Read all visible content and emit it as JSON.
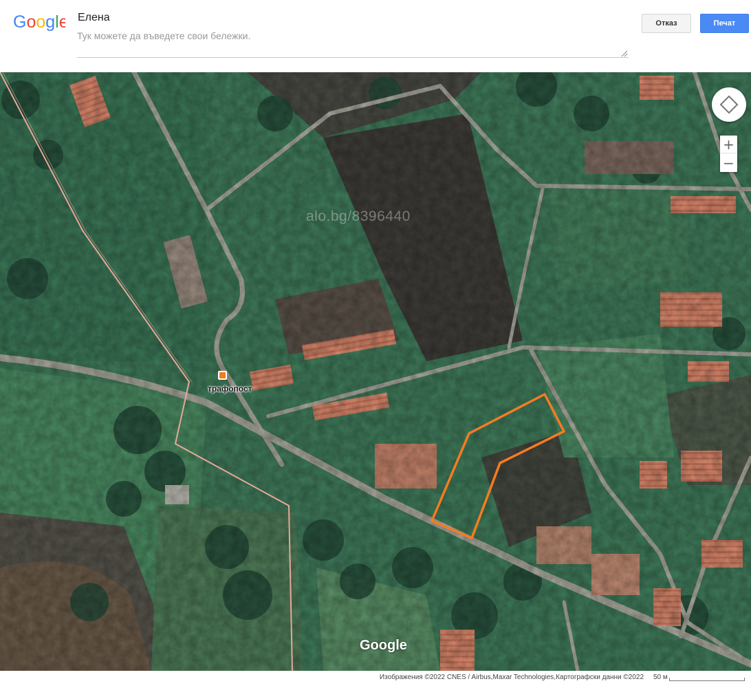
{
  "header": {
    "logo_text": "Google",
    "logo_colors": [
      "#4285F4",
      "#EA4335",
      "#FBBC05",
      "#4285F4",
      "#34A853",
      "#EA4335"
    ],
    "title": "Елена",
    "notes_placeholder": "Тук можете да въведете свои бележки.",
    "cancel_label": "Отказ",
    "print_label": "Печат"
  },
  "map": {
    "view": "satellite",
    "watermark": "alo.bg/8396440",
    "poi": {
      "label": "трафопост",
      "icon": "square-marker-icon",
      "color": "#F07C20"
    },
    "parcel_outline_color": "#F57C20",
    "boundary_line_color": "#E8A89A",
    "controls": {
      "pan_icon": "pan-arrows-icon",
      "zoom_in": "+",
      "zoom_out": "−"
    },
    "map_logo": "Google"
  },
  "footer": {
    "attribution": "Изображения ©2022 CNES / Airbus,Maxar Technologies,Картографски данни ©2022",
    "scale_label": "50 м"
  }
}
